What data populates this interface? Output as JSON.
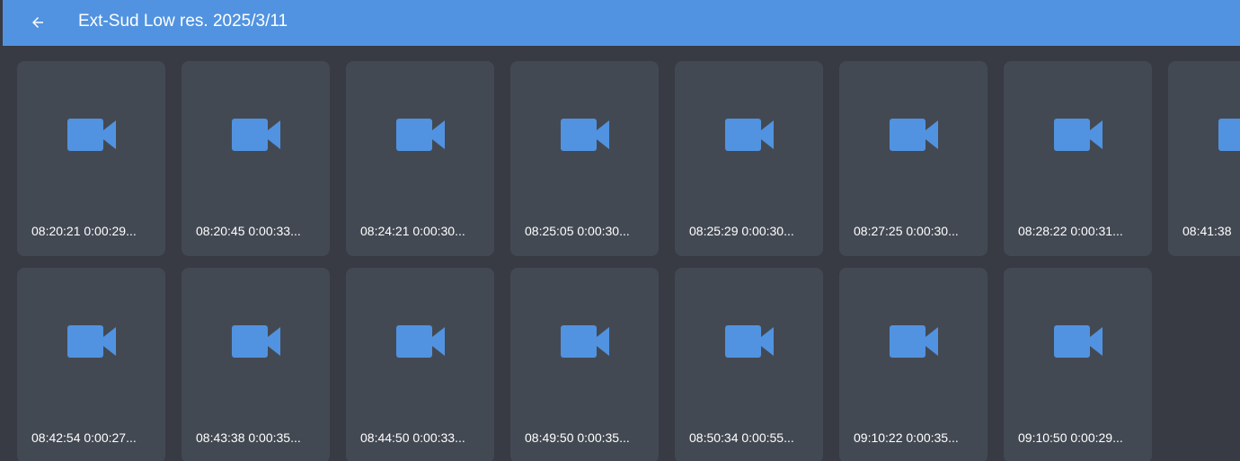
{
  "header": {
    "title": "Ext-Sud Low res. 2025/3/11",
    "back_icon": "arrow-left-icon"
  },
  "colors": {
    "accent": "#5193e0",
    "background": "#383a44",
    "tile": "#434953",
    "text": "#ffffff"
  },
  "videos": [
    {
      "label": "08:20:21 0:00:29...",
      "icon": "video-camera-icon"
    },
    {
      "label": "08:20:45 0:00:33...",
      "icon": "video-camera-icon"
    },
    {
      "label": "08:24:21 0:00:30...",
      "icon": "video-camera-icon"
    },
    {
      "label": "08:25:05 0:00:30...",
      "icon": "video-camera-icon"
    },
    {
      "label": "08:25:29 0:00:30...",
      "icon": "video-camera-icon"
    },
    {
      "label": "08:27:25 0:00:30...",
      "icon": "video-camera-icon"
    },
    {
      "label": "08:28:22 0:00:31...",
      "icon": "video-camera-icon"
    },
    {
      "label": "08:41:38",
      "icon": "video-camera-icon"
    },
    {
      "label": "08:42:54 0:00:27...",
      "icon": "video-camera-icon"
    },
    {
      "label": "08:43:38 0:00:35...",
      "icon": "video-camera-icon"
    },
    {
      "label": "08:44:50 0:00:33...",
      "icon": "video-camera-icon"
    },
    {
      "label": "08:49:50 0:00:35...",
      "icon": "video-camera-icon"
    },
    {
      "label": "08:50:34 0:00:55...",
      "icon": "video-camera-icon"
    },
    {
      "label": "09:10:22 0:00:35...",
      "icon": "video-camera-icon"
    },
    {
      "label": "09:10:50 0:00:29...",
      "icon": "video-camera-icon"
    }
  ]
}
